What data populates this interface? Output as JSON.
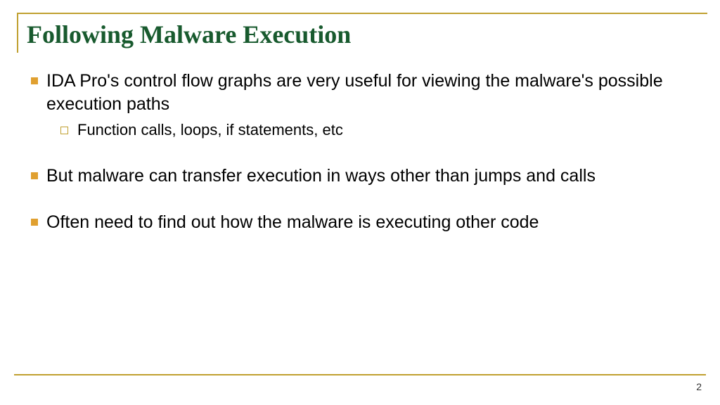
{
  "title": "Following Malware Execution",
  "bullets": [
    {
      "text": "IDA Pro's control flow graphs are very useful for viewing the malware's possible execution paths",
      "sub": [
        "Function calls, loops, if statements, etc"
      ]
    },
    {
      "text": "But malware can transfer execution in ways other than jumps and calls",
      "sub": []
    },
    {
      "text": "Often need to find out how the malware is executing other code",
      "sub": []
    }
  ],
  "page_number": "2"
}
